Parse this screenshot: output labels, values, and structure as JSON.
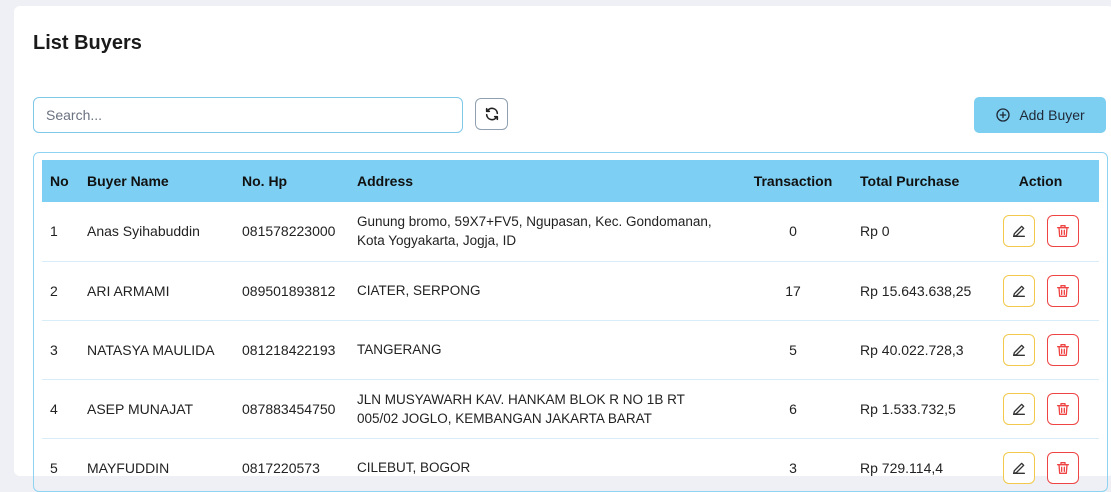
{
  "page": {
    "title": "List Buyers"
  },
  "toolbar": {
    "search_placeholder": "Search...",
    "refresh_icon": "refresh-icon",
    "add_label": "Add Buyer",
    "add_icon": "plus-circle-icon"
  },
  "table": {
    "headers": {
      "no": "No",
      "name": "Buyer Name",
      "phone": "No. Hp",
      "address": "Address",
      "transaction": "Transaction",
      "total": "Total Purchase",
      "action": "Action"
    },
    "rows": [
      {
        "no": "1",
        "name": "Anas Syihabuddin",
        "phone": "081578223000",
        "address": "Gunung bromo, 59X7+FV5, Ngupasan, Kec. Gondomanan, Kota Yogyakarta, Jogja, ID",
        "transaction": "0",
        "total": "Rp 0"
      },
      {
        "no": "2",
        "name": "ARI ARMAMI",
        "phone": "089501893812",
        "address": "CIATER, SERPONG",
        "transaction": "17",
        "total": "Rp 15.643.638,25"
      },
      {
        "no": "3",
        "name": "NATASYA MAULIDA",
        "phone": "081218422193",
        "address": "TANGERANG",
        "transaction": "5",
        "total": "Rp 40.022.728,3"
      },
      {
        "no": "4",
        "name": "ASEP MUNAJAT",
        "phone": "087883454750",
        "address": "JLN MUSYAWARH KAV. HANKAM BLOK R NO 1B RT 005/02 JOGLO, KEMBANGAN JAKARTA BARAT",
        "transaction": "6",
        "total": "Rp 1.533.732,5"
      },
      {
        "no": "5",
        "name": "MAYFUDDIN",
        "phone": "0817220573",
        "address": "CILEBUT, BOGOR",
        "transaction": "3",
        "total": "Rp 729.114,4"
      }
    ]
  },
  "colors": {
    "accent": "#7dd0f3",
    "edit": "#f2c94c",
    "delete": "#ef4444"
  }
}
